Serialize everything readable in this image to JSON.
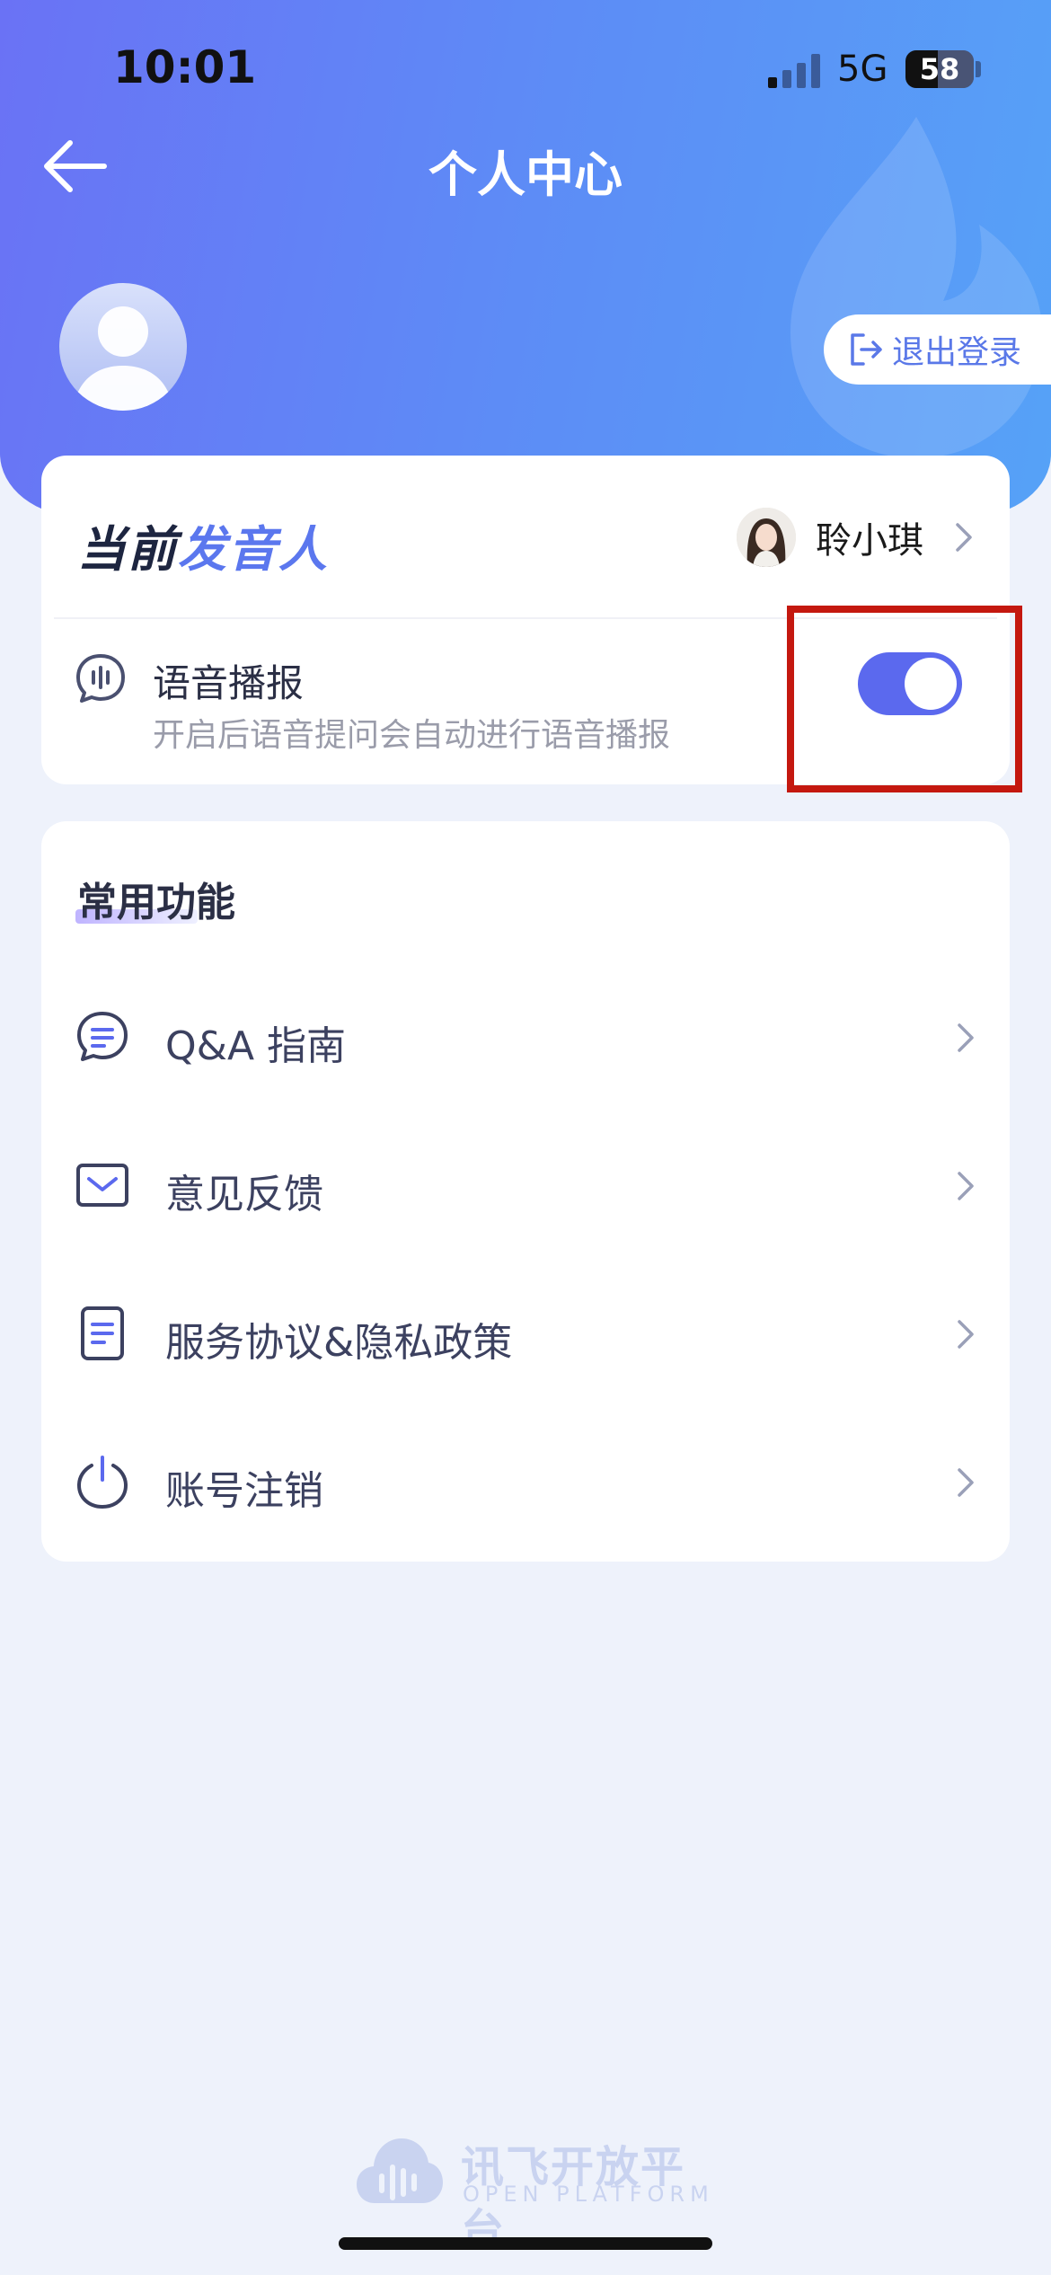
{
  "status_bar": {
    "time": "10:01",
    "network": "5G",
    "battery": "58"
  },
  "header": {
    "title": "个人中心",
    "logout_label": "退出登录"
  },
  "voice_card": {
    "title_part1": "当前",
    "title_part2": "发音人",
    "speaker_name": "聆小琪",
    "broadcast_title": "语音播报",
    "broadcast_desc": "开启后语音提问会自动进行语音播报",
    "broadcast_enabled": true
  },
  "functions": {
    "title": "常用功能",
    "items": [
      {
        "label": "Q&A 指南",
        "icon": "chat-bubble-icon"
      },
      {
        "label": "意见反馈",
        "icon": "mail-icon"
      },
      {
        "label": "服务协议&隐私政策",
        "icon": "document-icon"
      },
      {
        "label": "账号注销",
        "icon": "power-icon"
      }
    ]
  },
  "footer": {
    "brand_cn": "讯飞开放平台",
    "brand_en": "OPEN PLATFORM"
  },
  "colors": {
    "accent": "#5b69ee",
    "highlight": "#c4180f"
  }
}
